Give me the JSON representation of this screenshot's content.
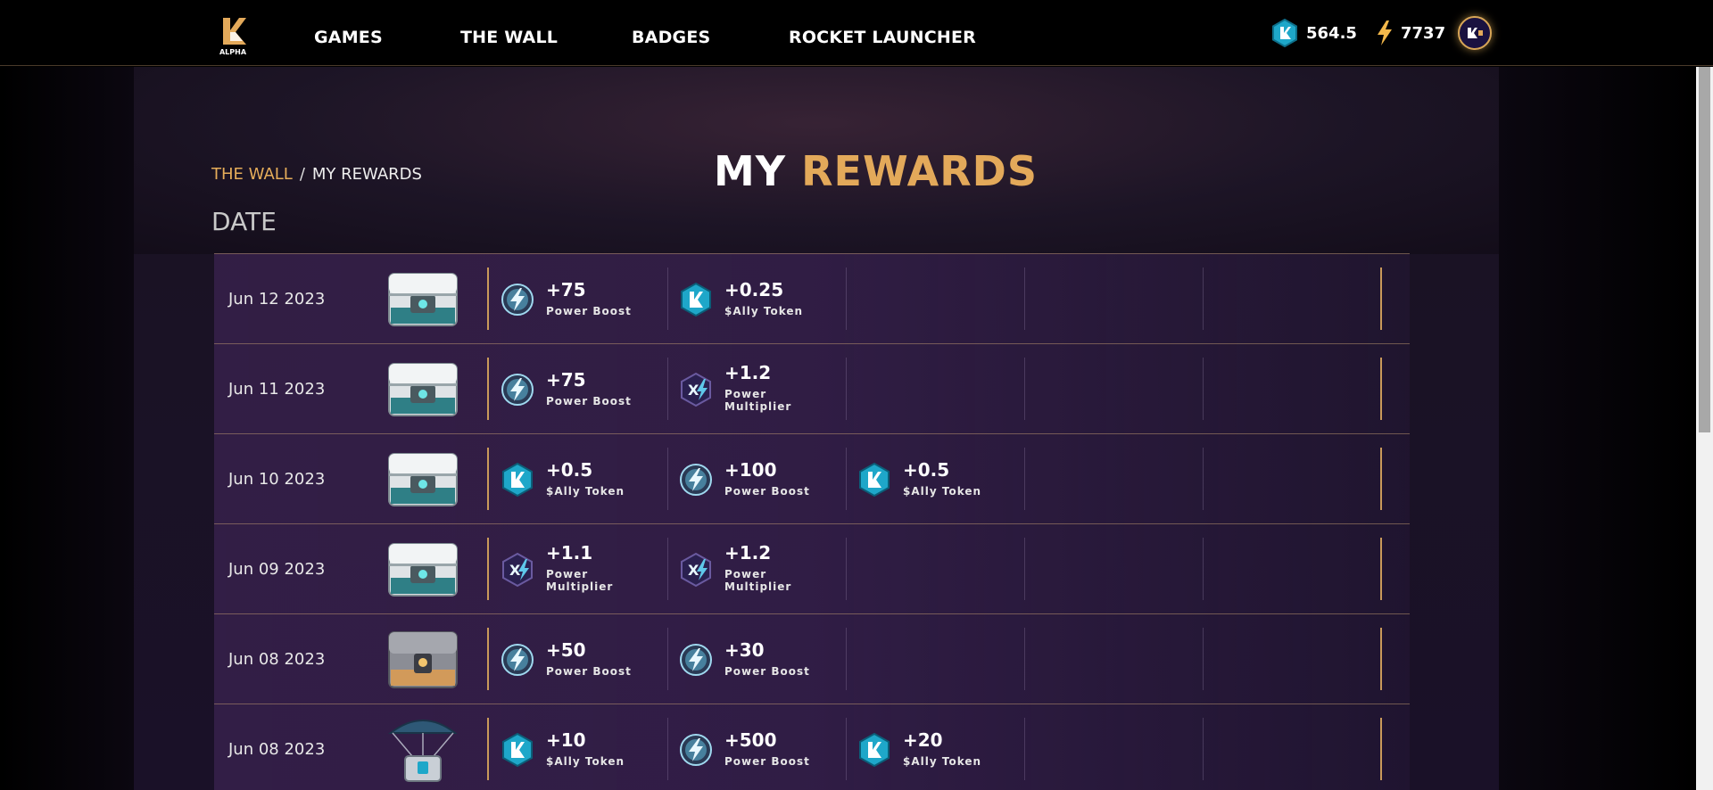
{
  "nav": {
    "logo_badge": "ALPHA",
    "items": [
      {
        "label": "GAMES"
      },
      {
        "label": "THE WALL"
      },
      {
        "label": "BADGES"
      },
      {
        "label": "ROCKET LAUNCHER"
      }
    ],
    "ally_token_balance": "564.5",
    "power_balance": "7737",
    "colors": {
      "accent": "#e3a95a",
      "token": "#1ea7c9",
      "power": "#f4b84a"
    }
  },
  "breadcrumb": {
    "link": "THE WALL",
    "separator": "/",
    "current": "MY REWARDS"
  },
  "title": {
    "part1": "MY",
    "part2": "REWARDS"
  },
  "date_header": "DATE",
  "rows": [
    {
      "date": "Jun 12 2023",
      "chest": "silver-teal-chest-icon",
      "rewards": [
        {
          "amount": "+75",
          "label": "Power Boost",
          "icon": "power-boost-icon"
        },
        {
          "amount": "+0.25",
          "label": "$Ally Token",
          "icon": "ally-token-icon"
        }
      ]
    },
    {
      "date": "Jun 11 2023",
      "chest": "silver-teal-chest-icon",
      "rewards": [
        {
          "amount": "+75",
          "label": "Power Boost",
          "icon": "power-boost-icon"
        },
        {
          "amount": "+1.2",
          "label": "Power Multiplier",
          "icon": "power-multiplier-icon"
        }
      ]
    },
    {
      "date": "Jun 10 2023",
      "chest": "silver-teal-chest-icon",
      "rewards": [
        {
          "amount": "+0.5",
          "label": "$Ally Token",
          "icon": "ally-token-icon"
        },
        {
          "amount": "+100",
          "label": "Power Boost",
          "icon": "power-boost-icon"
        },
        {
          "amount": "+0.5",
          "label": "$Ally Token",
          "icon": "ally-token-icon"
        }
      ]
    },
    {
      "date": "Jun 09 2023",
      "chest": "silver-teal-chest-icon",
      "rewards": [
        {
          "amount": "+1.1",
          "label": "Power Multiplier",
          "icon": "power-multiplier-icon"
        },
        {
          "amount": "+1.2",
          "label": "Power Multiplier",
          "icon": "power-multiplier-icon"
        }
      ]
    },
    {
      "date": "Jun 08 2023",
      "chest": "gold-chest-icon",
      "rewards": [
        {
          "amount": "+50",
          "label": "Power Boost",
          "icon": "power-boost-icon"
        },
        {
          "amount": "+30",
          "label": "Power Boost",
          "icon": "power-boost-icon"
        }
      ]
    },
    {
      "date": "Jun 08 2023",
      "chest": "parachute-crate-icon",
      "rewards": [
        {
          "amount": "+10",
          "label": "$Ally Token",
          "icon": "ally-token-icon"
        },
        {
          "amount": "+500",
          "label": "Power Boost",
          "icon": "power-boost-icon"
        },
        {
          "amount": "+20",
          "label": "$Ally Token",
          "icon": "ally-token-icon"
        }
      ]
    }
  ]
}
